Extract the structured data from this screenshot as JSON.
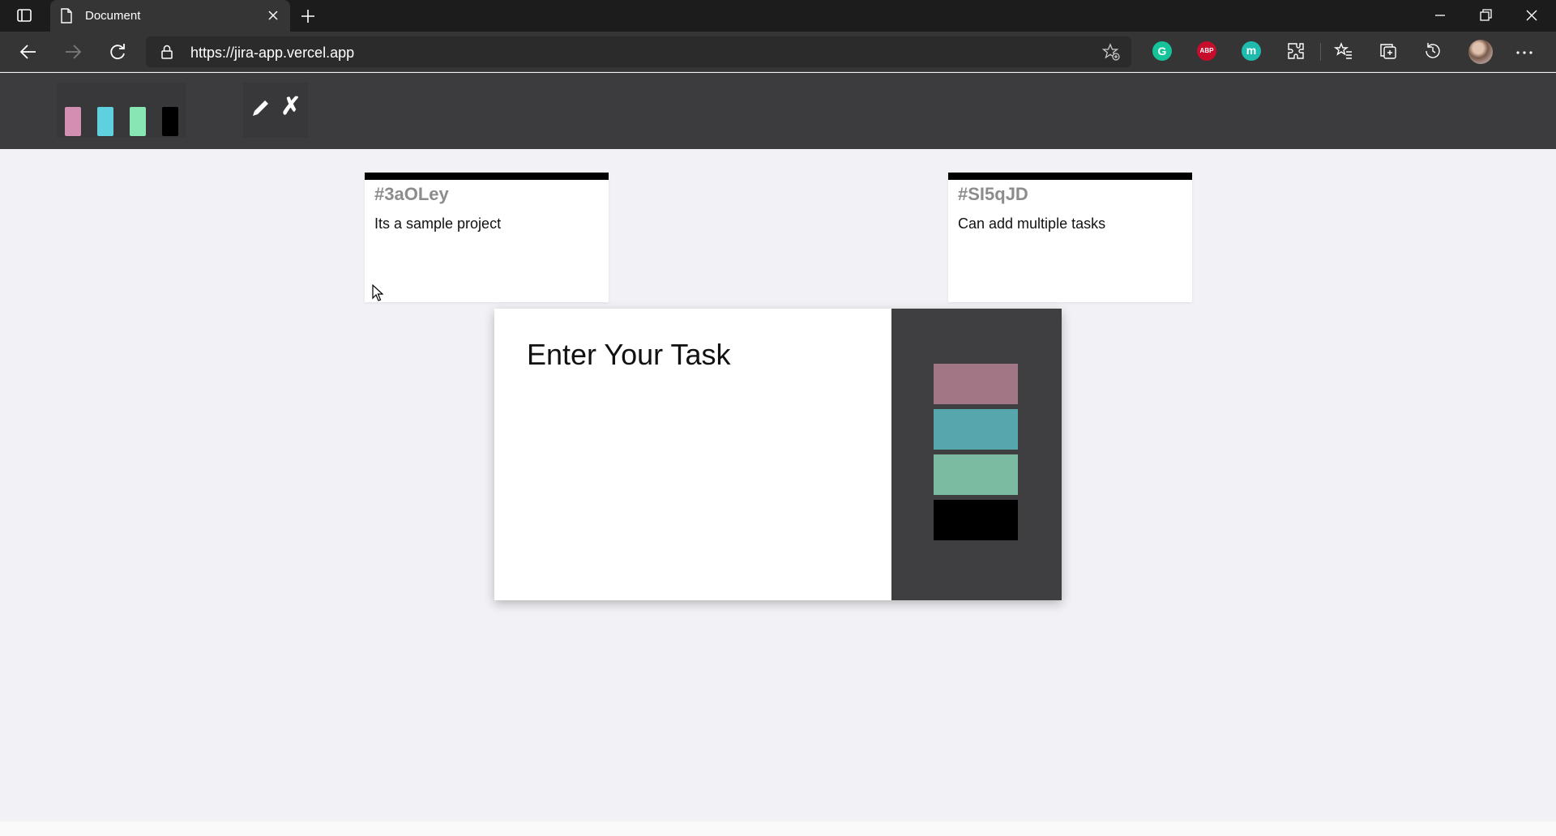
{
  "browser": {
    "tab": {
      "title": "Document",
      "icon": "document-icon"
    },
    "url": "https://jira-app.vercel.app",
    "extensions": [
      {
        "name": "grammarly",
        "label": "G",
        "color": "#15c39a"
      },
      {
        "name": "adblock-plus",
        "label": "ABP",
        "color": "#c70d2c"
      },
      {
        "name": "m-extension",
        "label": "m",
        "color": "#1fbcae"
      }
    ]
  },
  "header": {
    "filters": [
      {
        "name": "pink",
        "color": "#d38fb1"
      },
      {
        "name": "blue",
        "color": "#5fd0dd"
      },
      {
        "name": "green",
        "color": "#87e6b3"
      },
      {
        "name": "black",
        "color": "#000000"
      }
    ],
    "actions": {
      "edit_icon": "pencil-icon",
      "remove_label": "✗"
    }
  },
  "tickets": [
    {
      "id": "#3aOLey",
      "desc": "Its a sample project"
    },
    {
      "id": "#SI5qJD",
      "desc": "Can add multiple tasks"
    }
  ],
  "modal": {
    "placeholder": "Enter Your Task",
    "priorities": [
      {
        "name": "pink",
        "color": "#a37686"
      },
      {
        "name": "blue",
        "color": "#56a7ad"
      },
      {
        "name": "green",
        "color": "#7bbba1"
      },
      {
        "name": "black",
        "color": "#000000"
      }
    ]
  }
}
